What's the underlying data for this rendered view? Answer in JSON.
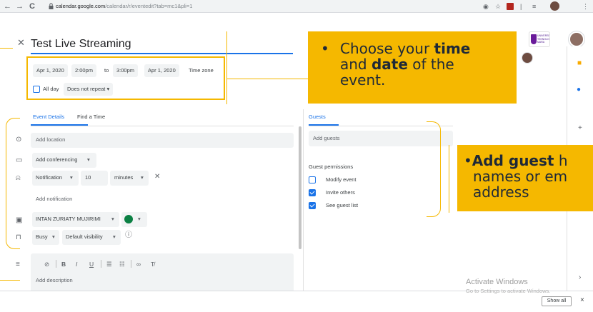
{
  "browser": {
    "back": "←",
    "forward": "→",
    "reload": "C",
    "url_host": "calendar.google.com",
    "url_path": "/calendar/r/eventedit?tab=mc1&pli=1"
  },
  "event": {
    "title": "Test Live Streaming",
    "start_date": "Apr 1, 2020",
    "start_time": "2:00pm",
    "to": "to",
    "end_time": "3:00pm",
    "end_date": "Apr 1, 2020",
    "time_zone": "Time zone",
    "all_day": "All day",
    "repeat": "Does not repeat"
  },
  "tabs": {
    "event_details": "Event Details",
    "find_a_time": "Find a Time"
  },
  "details": {
    "add_location": "Add location",
    "add_conferencing": "Add conferencing",
    "notification_type": "Notification",
    "notification_value": "10",
    "notification_unit": "minutes",
    "add_notification": "Add notification",
    "calendar_owner": "INTAN ZURIATY MUJIRIMI",
    "busy": "Busy",
    "visibility": "Default visibility",
    "add_description": "Add description"
  },
  "guests": {
    "tab": "Guests",
    "add_guests": "Add guests",
    "permissions_title": "Guest permissions",
    "permissions": [
      {
        "label": "Modify event",
        "checked": false
      },
      {
        "label": "Invite others",
        "checked": true
      },
      {
        "label": "See guest list",
        "checked": true
      }
    ]
  },
  "logo_text": "UNIVERSITI TEKNOLOGI MARA",
  "callouts": {
    "time_date": {
      "bullet": "•",
      "line1_pre": "Choose your ",
      "line1_bold": "time",
      "line2_pre": "and ",
      "line2_bold": "date",
      "line2_post": " of the",
      "line3": "event."
    },
    "guests": {
      "bullet": "•",
      "line1_bold": "Add guest",
      "line1_post": " h",
      "line2": "names or em",
      "line3": "address"
    }
  },
  "windows": {
    "activate_title": "Activate Windows",
    "activate_sub": "Go to Settings to activate Windows."
  },
  "footer": {
    "show_all": "Show all",
    "close": "×"
  },
  "colors": {
    "accent": "#1a73e8",
    "callout": "#f5b800",
    "calendar_color": "#0b8043"
  }
}
